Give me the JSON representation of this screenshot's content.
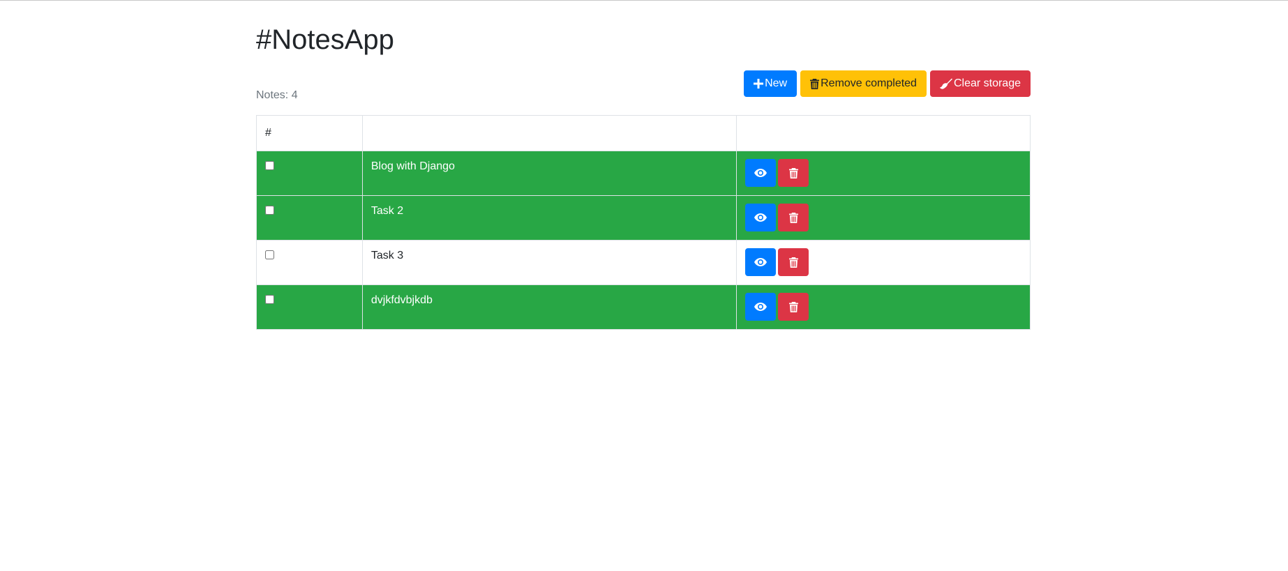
{
  "app": {
    "title": "#NotesApp",
    "count_text": "Notes: 4"
  },
  "toolbar": {
    "new_label": "New",
    "new_icon": "plus-icon",
    "remove_completed_label": "Remove completed",
    "remove_completed_icon": "trash-icon",
    "clear_storage_label": "Clear storage",
    "clear_storage_icon": "broom-icon"
  },
  "table": {
    "headers": [
      "#",
      "",
      ""
    ],
    "rows": [
      {
        "title": "Blog with Django",
        "completed": true
      },
      {
        "title": "Task 2",
        "completed": true
      },
      {
        "title": "Task 3",
        "completed": false
      },
      {
        "title": "dvjkfdvbjkdb",
        "completed": true
      }
    ],
    "row_actions": [
      "eye-icon",
      "trash-icon"
    ]
  },
  "colors": {
    "primary": "#007bff",
    "warning": "#ffc107",
    "danger": "#dc3545",
    "success": "#28a745",
    "muted": "#6c757d"
  }
}
